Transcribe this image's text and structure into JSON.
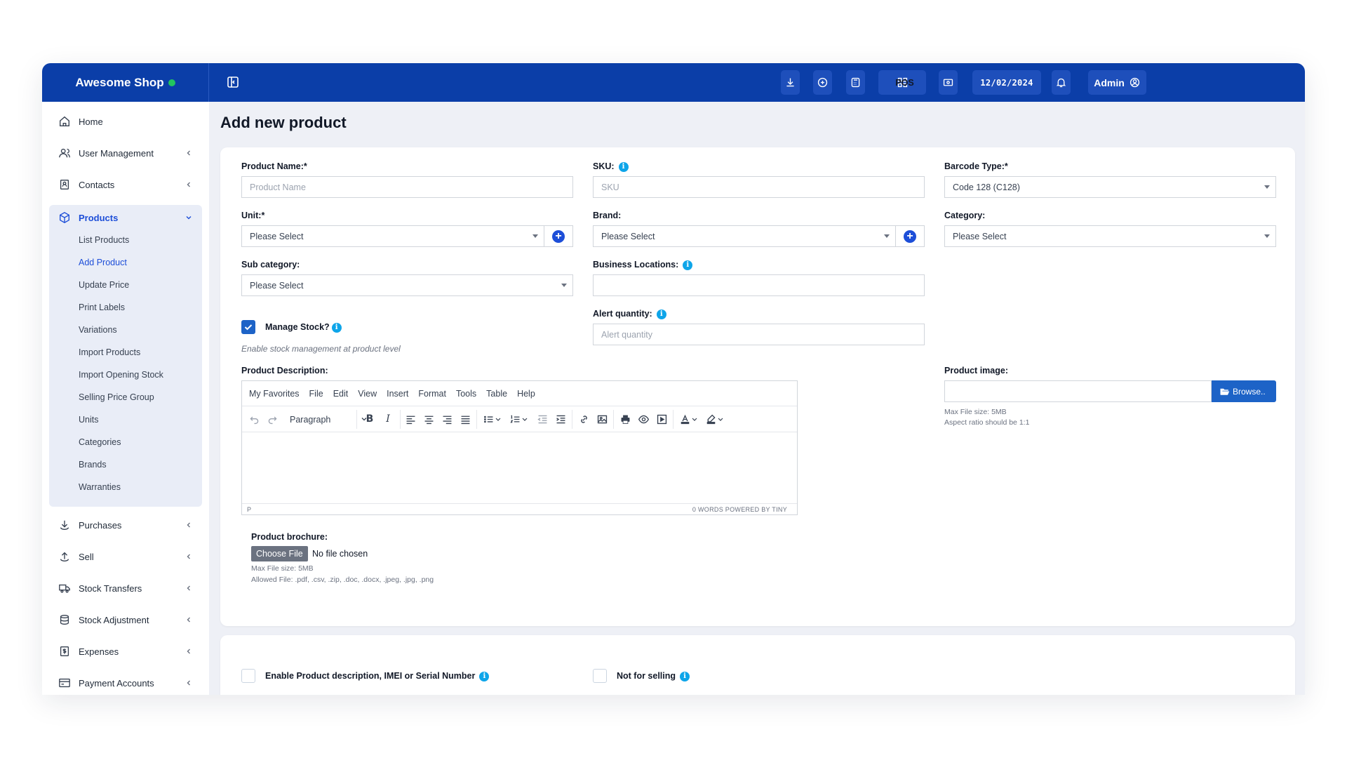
{
  "app": {
    "brand_name": "Awesome Shop",
    "header": {
      "pos_label": "POS",
      "date": "12/02/2024",
      "admin_label": "Admin"
    }
  },
  "sidebar": {
    "items": {
      "home": "Home",
      "user_management": "User Management",
      "contacts": "Contacts",
      "products": "Products",
      "purchases": "Purchases",
      "sell": "Sell",
      "stock_transfers": "Stock Transfers",
      "stock_adjustment": "Stock Adjustment",
      "expenses": "Expenses",
      "payment_accounts": "Payment Accounts"
    },
    "products_sub": [
      "List Products",
      "Add Product",
      "Update Price",
      "Print Labels",
      "Variations",
      "Import Products",
      "Import Opening Stock",
      "Selling Price Group",
      "Units",
      "Categories",
      "Brands",
      "Warranties"
    ]
  },
  "page": {
    "title": "Add new product"
  },
  "form": {
    "product_name": {
      "label": "Product Name:*",
      "placeholder": "Product Name"
    },
    "sku": {
      "label": "SKU:",
      "placeholder": "SKU"
    },
    "barcode_type": {
      "label": "Barcode Type:*",
      "value": "Code 128 (C128)"
    },
    "unit": {
      "label": "Unit:*",
      "value": "Please Select"
    },
    "brand": {
      "label": "Brand:",
      "value": "Please Select"
    },
    "category": {
      "label": "Category:",
      "value": "Please Select"
    },
    "sub_category": {
      "label": "Sub category:",
      "value": "Please Select"
    },
    "business_locations": {
      "label": "Business Locations:",
      "value": ""
    },
    "manage_stock": {
      "label": "Manage Stock?",
      "hint": "Enable stock management at product level",
      "checked": true
    },
    "alert_quantity": {
      "label": "Alert quantity:",
      "placeholder": "Alert quantity"
    },
    "product_description": {
      "label": "Product Description:"
    },
    "product_image": {
      "label": "Product image:",
      "browse_label": "Browse..",
      "max_size": "Max File size: 5MB",
      "aspect": "Aspect ratio should be 1:1"
    },
    "product_brochure": {
      "label": "Product brochure:",
      "choose_label": "Choose File",
      "no_file": "No file chosen",
      "max_size": "Max File size: 5MB",
      "allowed": "Allowed File: .pdf, .csv, .zip, .doc, .docx, .jpeg, .jpg, .png"
    },
    "enable_imei": {
      "label": "Enable Product description, IMEI or Serial Number",
      "checked": false
    },
    "not_for_selling": {
      "label": "Not for selling",
      "checked": false
    }
  },
  "editor": {
    "menu": [
      "My Favorites",
      "File",
      "Edit",
      "View",
      "Insert",
      "Format",
      "Tools",
      "Table",
      "Help"
    ],
    "block_format": "Paragraph",
    "status_path": "P",
    "status_right": "0 WORDS  POWERED BY TINY"
  },
  "colors": {
    "header_bg": "#0b3ea8",
    "accent": "#1d4ed8",
    "status_online": "#22c55e",
    "info": "#0ea5e9"
  }
}
